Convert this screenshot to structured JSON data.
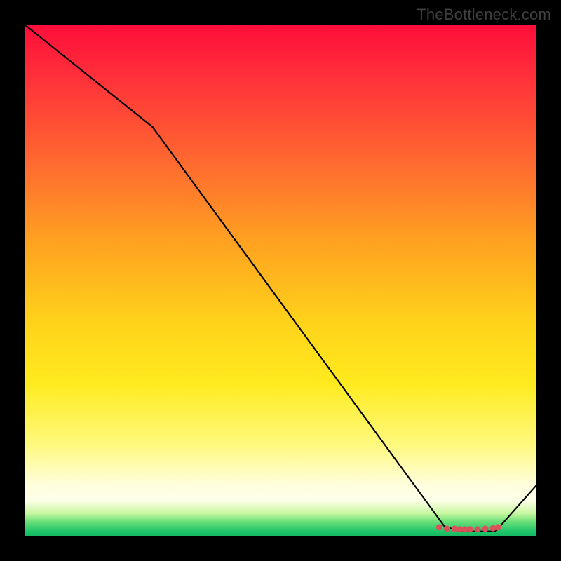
{
  "watermark": "TheBottleneck.com",
  "chart_data": {
    "type": "line",
    "title": "",
    "xlabel": "",
    "ylabel": "",
    "xlim": [
      0,
      100
    ],
    "ylim": [
      0,
      100
    ],
    "series": [
      {
        "name": "curve",
        "x": [
          0,
          25,
          82,
          85,
          92,
          100
        ],
        "values": [
          100,
          80,
          2,
          1,
          1,
          10
        ]
      }
    ],
    "markers": {
      "name": "bottom-cluster",
      "color": "#d9525a",
      "x": [
        81,
        82.5,
        84,
        85,
        86,
        87,
        88.5,
        90,
        91.5,
        92.5
      ],
      "values": [
        1.8,
        1.5,
        1.5,
        1.4,
        1.4,
        1.4,
        1.4,
        1.5,
        1.6,
        1.8
      ]
    },
    "grid": false,
    "legend": false
  }
}
